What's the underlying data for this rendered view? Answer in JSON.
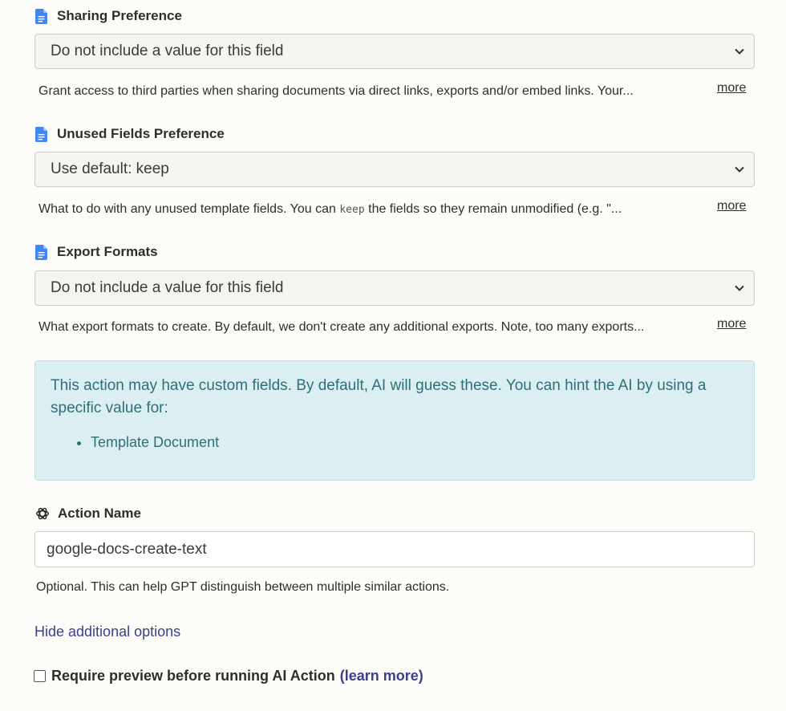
{
  "fields": [
    {
      "label": "Sharing Preference",
      "icon": "google-docs-icon",
      "value": "Do not include a value for this field",
      "help": "Grant access to third parties when sharing documents via direct links, exports and/or embed links. Your...",
      "more": "more"
    },
    {
      "label": "Unused Fields Preference",
      "icon": "google-docs-icon",
      "value": "Use default: keep",
      "help_before": "What to do with any unused template fields. You can ",
      "help_code": "keep",
      "help_after": " the fields so they remain unmodified (e.g. \"...",
      "more": "more"
    },
    {
      "label": "Export Formats",
      "icon": "google-docs-icon",
      "value": "Do not include a value for this field",
      "help": "What export formats to create. By default, we don't create any additional exports. Note, too many exports...",
      "more": "more"
    }
  ],
  "info": {
    "text": "This action may have custom fields. By default, AI will guess these. You can hint the AI by using a specific value for:",
    "items": [
      "Template Document"
    ]
  },
  "action_name": {
    "label": "Action Name",
    "icon": "openai-icon",
    "value": "google-docs-create-text",
    "help": "Optional. This can help GPT distinguish between multiple similar actions."
  },
  "hide_options": "Hide additional options",
  "preview": {
    "label": "Require preview before running AI Action",
    "learn_more": "(learn more)",
    "checked": false
  },
  "colors": {
    "doc_icon": "#4285f4",
    "info_bg": "#dbeff3",
    "info_text": "#2f6f77",
    "link": "#3b3f8f"
  }
}
